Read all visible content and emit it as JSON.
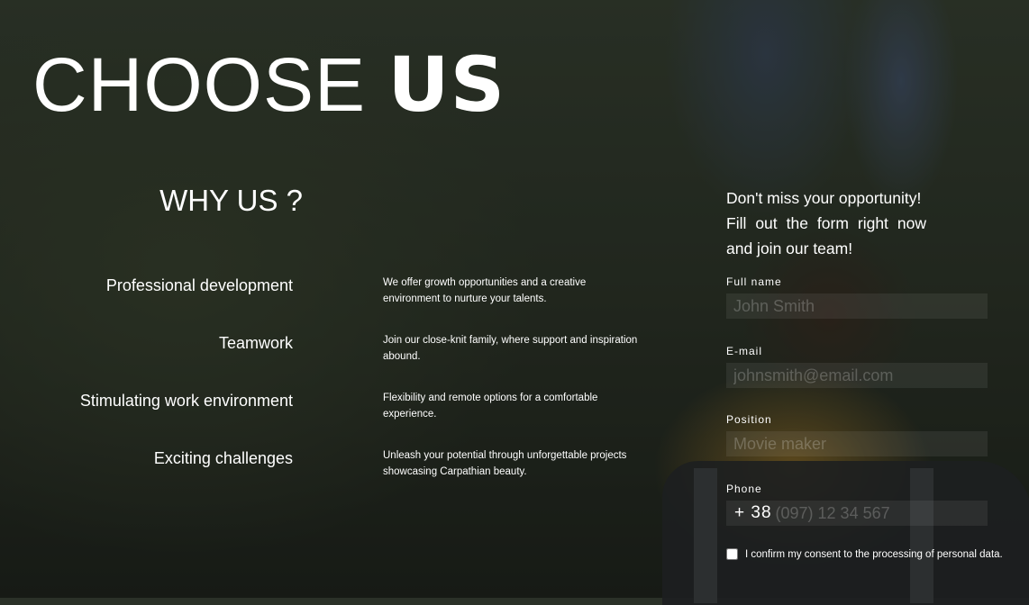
{
  "header": {
    "title_light": "CHOOSE ",
    "title_bold": "US"
  },
  "why": {
    "heading": "WHY US ?",
    "features": [
      {
        "title": "Professional development",
        "description": "We offer growth opportunities and a creative environment to nurture your talents."
      },
      {
        "title": "Teamwork",
        "description": "Join our close-knit family, where support and inspiration abound."
      },
      {
        "title": "Stimulating work environment",
        "description": "Flexibility and remote options for a comfortable experience."
      },
      {
        "title": "Exciting challenges",
        "description": "Unleash your potential through unforgettable projects showcasing Carpathian beauty."
      }
    ]
  },
  "form": {
    "promo_line1": "Don't miss your opportunity!",
    "promo_line2": "Fill out the form right now",
    "promo_line3": "and join our team!",
    "full_name": {
      "label": "Full name",
      "placeholder": "John Smith",
      "value": ""
    },
    "email": {
      "label": "E-mail",
      "placeholder": "johnsmith@email.com",
      "value": ""
    },
    "position": {
      "label": "Position",
      "placeholder": "Movie maker",
      "value": ""
    },
    "phone": {
      "label": "Phone",
      "prefix": "+ 38",
      "placeholder": "(097) 12 34 567",
      "value": ""
    },
    "consent": {
      "label": "I confirm my consent to the processing of personal data.",
      "checked": false
    }
  }
}
